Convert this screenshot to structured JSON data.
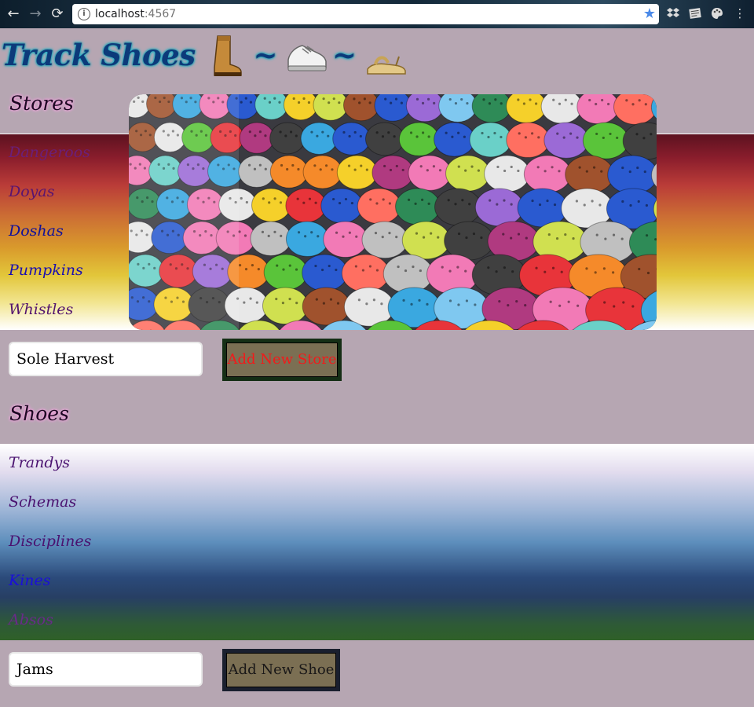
{
  "browser": {
    "url_host": "localhost",
    "url_port": ":4567",
    "back_icon": "arrow-left",
    "forward_icon": "arrow-right",
    "reload_icon": "reload",
    "bookmark_icon": "star",
    "extensions": [
      "dropbox-icon",
      "notes-icon",
      "palette-icon",
      "menu-kebab-icon"
    ]
  },
  "header": {
    "title": "Track Shoes",
    "separator": "~",
    "icons": [
      "boot-icon",
      "sneaker-icon",
      "sandal-icon"
    ]
  },
  "stores": {
    "heading": "Stores",
    "items": [
      {
        "label": "Dangeroos",
        "color": "#6a1f7a"
      },
      {
        "label": "Doyas",
        "color": "#5a1470"
      },
      {
        "label": "Doshas",
        "color": "#10109a"
      },
      {
        "label": "Pumpkins",
        "color": "#1a0fb0"
      },
      {
        "label": "Whistles",
        "color": "#52146e"
      }
    ],
    "input_value": "Sole Harvest",
    "button_label": "Add New Store"
  },
  "shoes": {
    "heading": "Shoes",
    "items": [
      {
        "label": "Trandys",
        "color": "#4a1270"
      },
      {
        "label": "Schemas",
        "color": "#4a1270"
      },
      {
        "label": "Disciplines",
        "color": "#4a1270"
      },
      {
        "label": "Kines",
        "color": "#1a0fd8"
      },
      {
        "label": "Absos",
        "color": "#6a2a8a"
      }
    ],
    "input_value": "Jams",
    "button_label": "Add New Shoe"
  },
  "hero_image": {
    "description_icon": "clogs-display-photo"
  },
  "colors": {
    "page_bg": "#b6a6b2",
    "button_bg": "#7b6f53",
    "store_button_text": "#f21a1a"
  }
}
